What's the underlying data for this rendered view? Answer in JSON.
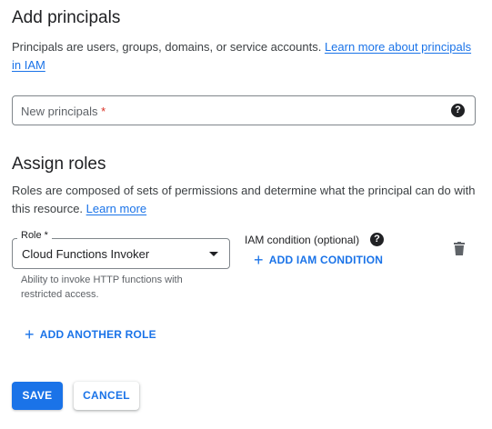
{
  "add_principals": {
    "title": "Add principals",
    "description": "Principals are users, groups, domains, or service accounts. ",
    "learn_more_link": "Learn more about principals in IAM",
    "input_placeholder": "New principals ",
    "required_mark": "*",
    "help_icon": "help-icon"
  },
  "assign_roles": {
    "title": "Assign roles",
    "description": "Roles are composed of sets of permissions and determine what the principal can do with this resource. ",
    "learn_more_link": "Learn more",
    "role": {
      "label": "Role *",
      "value": "Cloud Functions Invoker",
      "hint": "Ability to invoke HTTP functions with restricted access."
    },
    "iam_condition": {
      "label": "IAM condition (optional)",
      "add_button": "ADD IAM CONDITION"
    },
    "delete_icon": "trash-icon",
    "add_another_role": "ADD ANOTHER ROLE"
  },
  "actions": {
    "save": "SAVE",
    "cancel": "CANCEL"
  },
  "colors": {
    "accent": "#1a73e8",
    "required": "#d93025"
  }
}
